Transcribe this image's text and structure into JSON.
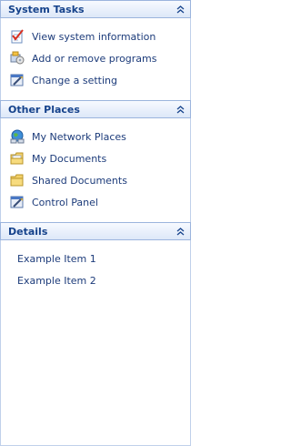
{
  "sections": [
    {
      "title": "System Tasks",
      "items": [
        {
          "label": "View system information",
          "icon": "system-info-icon"
        },
        {
          "label": "Add or remove programs",
          "icon": "programs-icon"
        },
        {
          "label": "Change a setting",
          "icon": "settings-icon"
        }
      ]
    },
    {
      "title": "Other Places",
      "items": [
        {
          "label": "My Network Places",
          "icon": "network-places-icon"
        },
        {
          "label": "My Documents",
          "icon": "my-documents-icon"
        },
        {
          "label": "Shared Documents",
          "icon": "shared-folder-icon"
        },
        {
          "label": "Control Panel",
          "icon": "control-panel-icon"
        }
      ]
    },
    {
      "title": "Details",
      "items": [
        {
          "label": "Example Item 1"
        },
        {
          "label": "Example Item 2"
        }
      ]
    }
  ],
  "colors": {
    "header_text": "#15428b",
    "link_text": "#1c3b7a",
    "header_border": "#9bb4dd"
  }
}
